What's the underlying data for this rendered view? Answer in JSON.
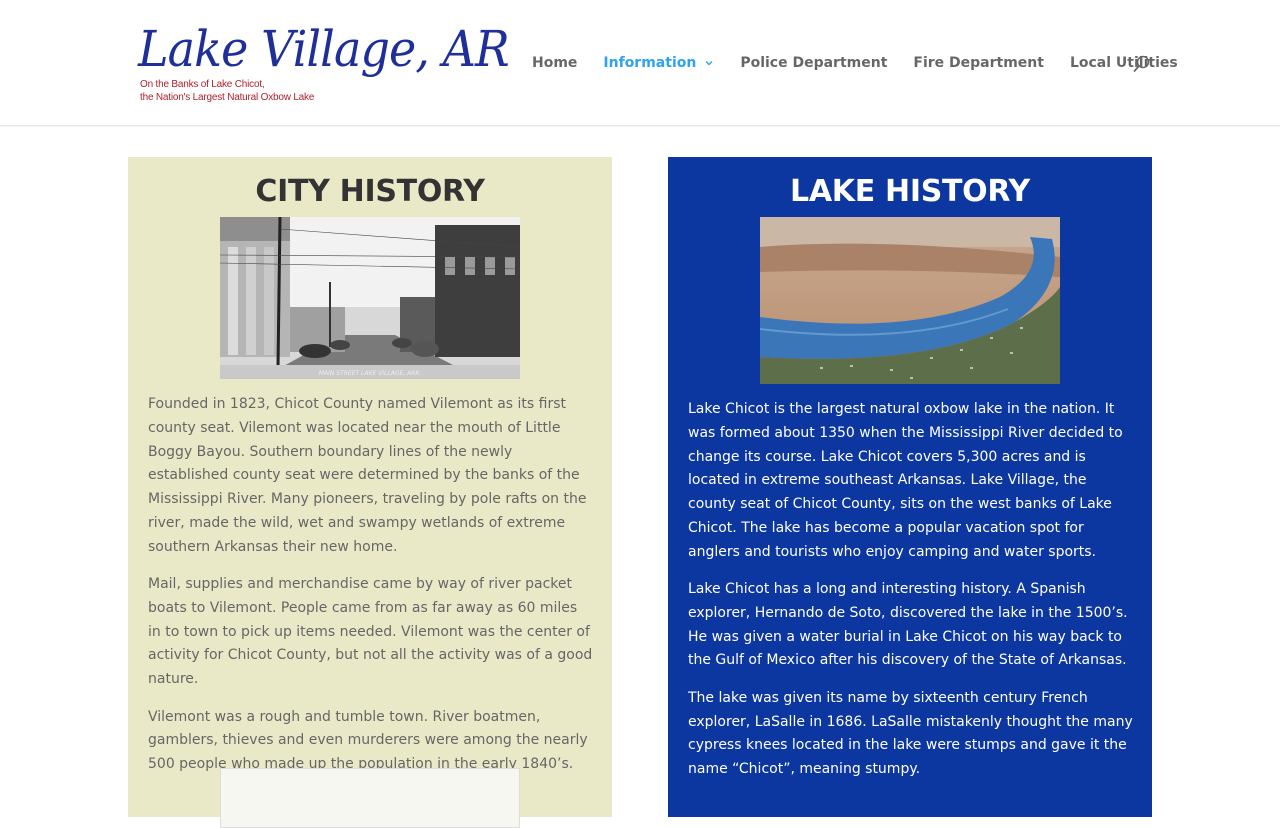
{
  "site": {
    "logo_title": "Lake Village, AR",
    "logo_tagline_1": "On the Banks of Lake Chicot,",
    "logo_tagline_2": "the Nation's Largest Natural Oxbow Lake"
  },
  "nav": {
    "items": [
      {
        "label": "Home"
      },
      {
        "label": "Information"
      },
      {
        "label": "Police Department"
      },
      {
        "label": "Fire Department"
      },
      {
        "label": "Local Utilities"
      }
    ],
    "active": "Information"
  },
  "city": {
    "title": "CITY HISTORY",
    "photo_caption": "MAIN STREET   LAKE VILLAGE, ARK.",
    "paragraphs": [
      "Founded in 1823, Chicot County named Vilemont as its first county seat. Vilemont was located near the mouth of Little Boggy Bayou. Southern boundary lines of the newly established county seat were determined by the banks of the Mississippi River. Many pioneers, traveling by pole rafts on the river, made the wild, wet and swampy wetlands of extreme southern Arkansas their new home.",
      "Mail, supplies and merchandise came by way of river packet boats to Vilemont. People came from as far away as 60 miles in to town to pick up items needed. Vilemont was the center of activity for Chicot County, but not all the activity was of a good nature.",
      "Vilemont was a rough and tumble town. River boatmen, gamblers, thieves and even murderers were among the nearly 500 people who made up the population in the early 1840’s."
    ]
  },
  "lake": {
    "title": "LAKE HISTORY",
    "paragraphs": [
      "Lake Chicot is the largest natural oxbow lake in the nation. It was formed about 1350 when the Mississippi River decided to change its course. Lake Chicot covers 5,300 acres and is located in extreme southeast Arkansas. Lake Village, the county seat of Chicot County, sits on the west banks of Lake Chicot. The lake has become a popular vacation spot for anglers and tourists who enjoy camping and water sports.",
      "Lake Chicot has a long and interesting history. A Spanish explorer, Hernando de Soto, discovered the lake in the 1500’s. He was given a water burial in Lake Chicot on his way back to the Gulf of Mexico after his discovery of the State of Arkansas.",
      "The lake was given its name by sixteenth century French explorer, LaSalle in 1686. LaSalle mistakenly thought the many cypress knees located in the lake were stumps and gave it the name “Chicot”, meaning stumpy."
    ]
  },
  "icons": {
    "search": "search-icon",
    "dropdown": "chevron-down-icon"
  },
  "colors": {
    "accent": "#2ea3f2",
    "logo_blue": "#1e2f9a",
    "logo_red": "#b0212d",
    "city_panel": "#e9e9c8",
    "lake_panel": "#0c36a0"
  }
}
